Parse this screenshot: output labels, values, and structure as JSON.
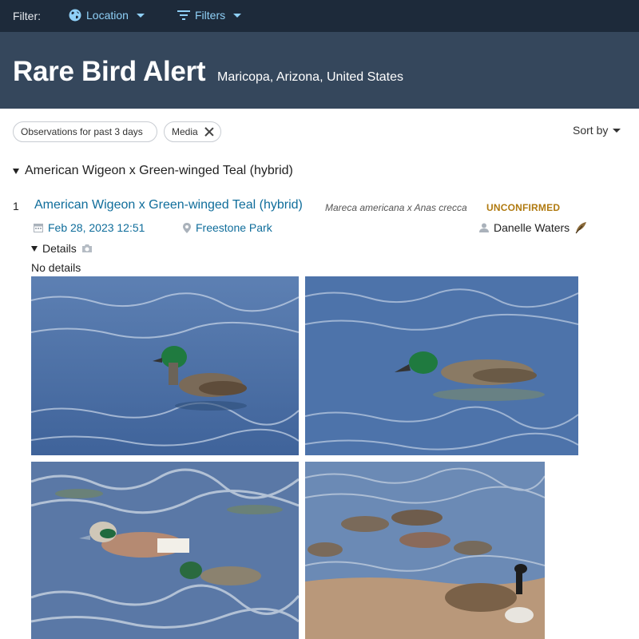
{
  "topbar": {
    "filter_label": "Filter:",
    "location_label": "Location",
    "filters_label": "Filters"
  },
  "header": {
    "title": "Rare Bird Alert",
    "region": "Maricopa, Arizona, United States"
  },
  "chips": {
    "observations": "Observations for past 3 days",
    "media": "Media"
  },
  "sort": {
    "label": "Sort by"
  },
  "group": {
    "title": "American Wigeon x Green-winged Teal (hybrid)"
  },
  "observation": {
    "index": "1",
    "common_name": "American Wigeon x Green-winged Teal (hybrid)",
    "scientific_name": "Mareca americana x Anas crecca",
    "status": "UNCONFIRMED",
    "date": "Feb 28, 2023 12:51",
    "location": "Freestone Park",
    "observer": "Danelle Waters",
    "details_label": "Details",
    "details_text": "No details"
  },
  "icons": {
    "location": "globe-icon",
    "filters": "filter-icon",
    "date": "calendar-icon",
    "place": "map-pin-icon",
    "observer": "person-icon",
    "feather": "feather-icon",
    "camera": "camera-icon"
  },
  "colors": {
    "topbar": "#1d2a3a",
    "header": "#35475c",
    "link": "#0f6d9b",
    "status": "#b07a10"
  }
}
